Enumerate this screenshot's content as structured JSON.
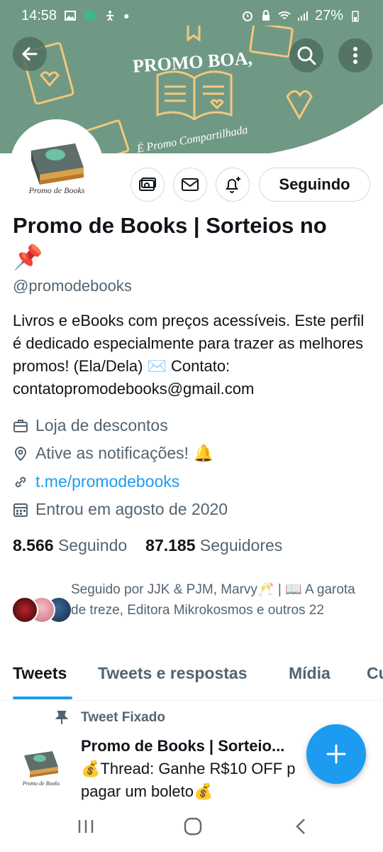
{
  "status_bar": {
    "time": "14:58",
    "battery": "27%"
  },
  "banner": {
    "title": "PROMO BOA,",
    "subtitle": "É Promo Compartilhada",
    "color": "#6f9985",
    "art_color": "#f3c77a"
  },
  "profile": {
    "display_name": "Promo de Books | Sorteios no",
    "name_emoji": "📌",
    "handle": "@promodebooks",
    "bio": "Livros e eBooks com preços acessíveis. Este perfil é dedicado especialmente para trazer as melhores promos! (Ela/Dela) ✉️ Contato: contatopromodebooks@gmail.com",
    "category": "Loja de descontos",
    "location": "Ative as notificações! 🔔",
    "link": "t.me/promodebooks",
    "joined": "Entrou em agosto de 2020",
    "following_count": "8.566",
    "following_label": "Seguindo",
    "followers_count": "87.185",
    "followers_label": "Seguidores",
    "followed_by": "Seguido por JJK & PJM, Marvy🥂 | 📖 A garota de treze, Editora Mikrokosmos e outros 22",
    "avatar_text": "Promo de Books"
  },
  "actions": {
    "following_button": "Seguindo",
    "icons": [
      "payment-icon",
      "message-icon",
      "notification-add-icon"
    ]
  },
  "tabs": [
    {
      "label": "Tweets",
      "active": true
    },
    {
      "label": "Tweets e respostas",
      "active": false
    },
    {
      "label": "Mídia",
      "active": false
    },
    {
      "label": "Cu",
      "active": false
    }
  ],
  "pinned_tweet": {
    "label": "Tweet Fixado",
    "author": "Promo de Books | Sorteio...",
    "line1": "💰Thread: Ganhe R$10 OFF p",
    "line2": "pagar um boleto💰"
  },
  "colors": {
    "accent": "#1d9bf0",
    "text_primary": "#0f1419",
    "text_secondary": "#536471"
  }
}
